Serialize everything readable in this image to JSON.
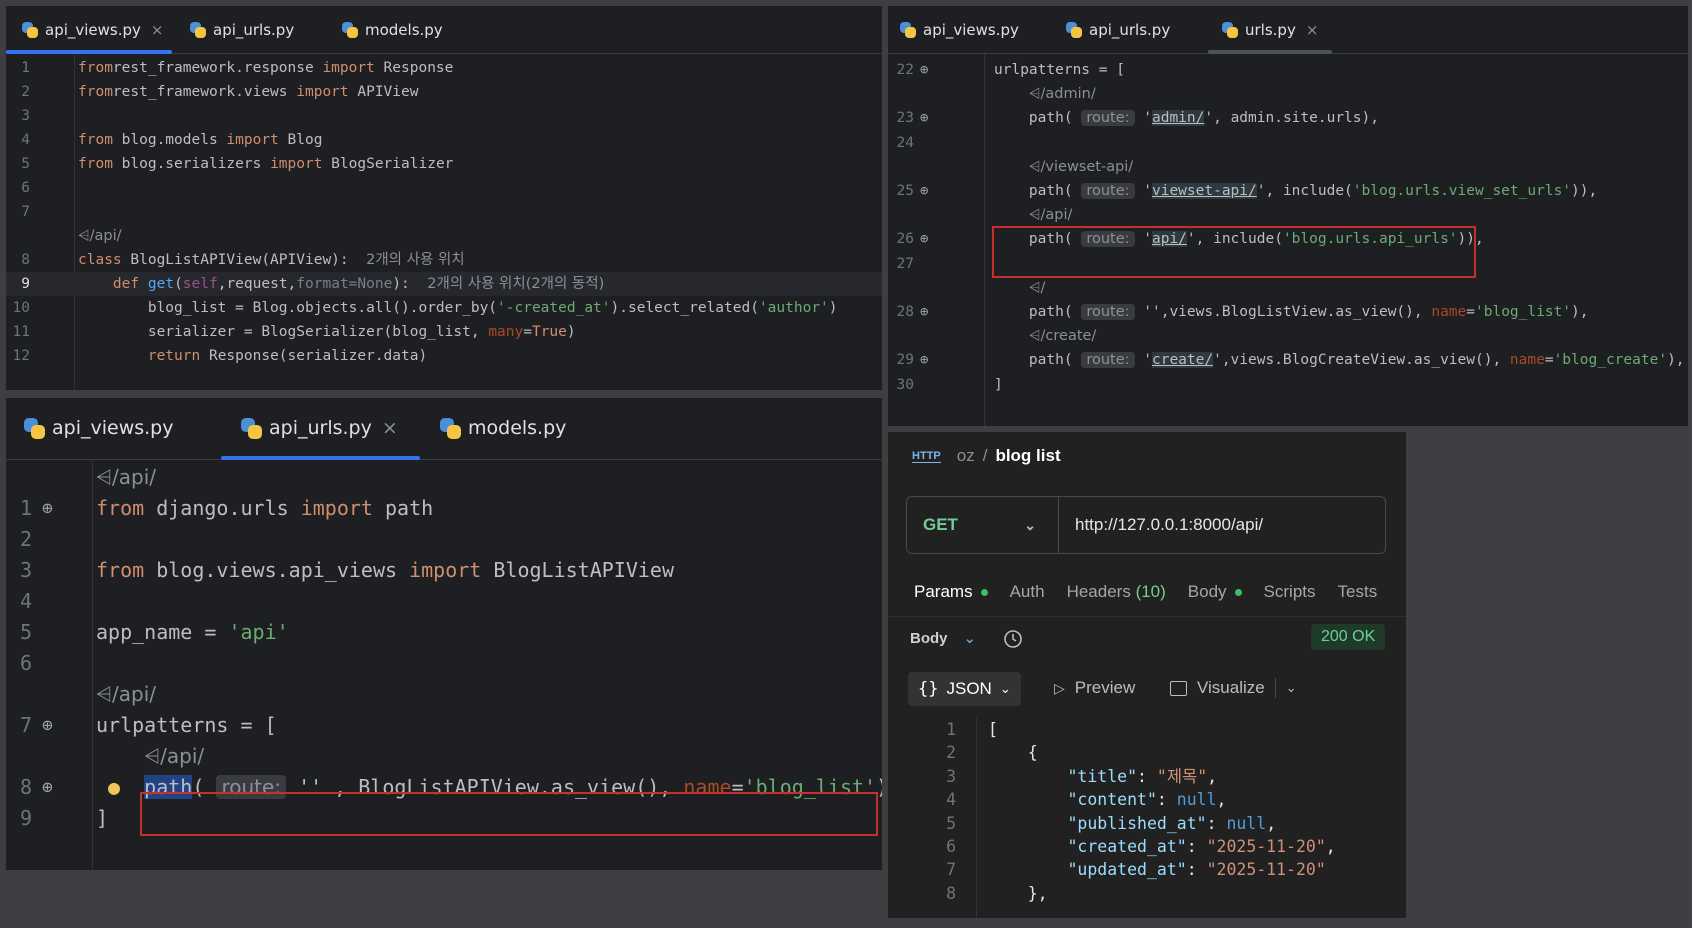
{
  "top_left": {
    "tabs": [
      {
        "label": "api_views.py",
        "active": true,
        "close": "×"
      },
      {
        "label": "api_urls.py",
        "active": false
      },
      {
        "label": "models.py",
        "active": false
      }
    ],
    "lines": [
      {
        "n": "1",
        "parts": [
          [
            "kw",
            "from"
          ],
          [
            "",
            "rest_framework.response "
          ],
          [
            "kw",
            "import"
          ],
          [
            "",
            " Response"
          ]
        ]
      },
      {
        "n": "2",
        "parts": [
          [
            "kw",
            "from"
          ],
          [
            "",
            "rest_framework.views "
          ],
          [
            "kw",
            "import"
          ],
          [
            "",
            " APIView"
          ]
        ]
      },
      {
        "n": "3",
        "parts": []
      },
      {
        "n": "4",
        "parts": [
          [
            "kw",
            "from"
          ],
          [
            "",
            " blog.models "
          ],
          [
            "kw",
            "import"
          ],
          [
            "",
            " Blog"
          ]
        ]
      },
      {
        "n": "5",
        "parts": [
          [
            "kw",
            "from"
          ],
          [
            "",
            " blog.serializers "
          ],
          [
            "kw",
            "import"
          ],
          [
            "",
            " BlogSerializer"
          ]
        ]
      },
      {
        "n": "6",
        "parts": []
      },
      {
        "n": "7",
        "parts": []
      },
      {
        "n": "",
        "parts": [
          [
            "ann",
            "⩤/api/"
          ]
        ]
      },
      {
        "n": "8",
        "parts": [
          [
            "kw",
            "class"
          ],
          [
            "",
            " BlogListAPIView(APIView):  "
          ],
          [
            "usage",
            "2개의 사용 위치"
          ]
        ]
      },
      {
        "n": "9",
        "parts": [
          [
            "",
            "    "
          ],
          [
            "kw",
            "def"
          ],
          [
            "",
            " "
          ],
          [
            "fn",
            "get"
          ],
          [
            "",
            "("
          ],
          [
            "slf",
            "self"
          ],
          [
            "",
            ",request,"
          ],
          [
            "grey",
            "format=None"
          ],
          [
            "",
            "):  "
          ],
          [
            "usage",
            "2개의 사용 위치(2개의 동적)"
          ]
        ]
      },
      {
        "n": "10",
        "parts": [
          [
            "",
            "        blog_list = Blog.objects.all().order_by("
          ],
          [
            "str",
            "'-created_at'"
          ],
          [
            "",
            ").select_related("
          ],
          [
            "str",
            "'author'"
          ],
          [
            "",
            ")"
          ]
        ]
      },
      {
        "n": "11",
        "parts": [
          [
            "",
            "        serializer = BlogSerializer(blog_list, "
          ],
          [
            "prm",
            "many"
          ],
          [
            "",
            "="
          ],
          [
            "kw",
            "True"
          ],
          [
            "",
            ")"
          ]
        ]
      },
      {
        "n": "12",
        "parts": [
          [
            "",
            "        "
          ],
          [
            "kw",
            "return"
          ],
          [
            "",
            " Response(serializer.data)"
          ]
        ]
      }
    ]
  },
  "top_right": {
    "tabs": [
      {
        "label": "api_views.py",
        "active": false
      },
      {
        "label": "api_urls.py",
        "active": false
      },
      {
        "label": "urls.py",
        "active": true,
        "close": "×"
      }
    ],
    "lines": [
      {
        "n": "22",
        "g": true,
        "parts": [
          [
            "",
            "urlpatterns = ["
          ]
        ]
      },
      {
        "n": "",
        "parts": [
          [
            "",
            "    "
          ],
          [
            "ann",
            "⩤/admin/"
          ]
        ]
      },
      {
        "n": "23",
        "g": true,
        "parts": [
          [
            "",
            "    path( "
          ],
          [
            "hint",
            "route:"
          ],
          [
            "",
            " '"
          ],
          [
            "ulink",
            "admin/"
          ],
          [
            "",
            "', admin.site.urls),"
          ]
        ]
      },
      {
        "n": "24",
        "parts": []
      },
      {
        "n": "",
        "parts": [
          [
            "",
            "    "
          ],
          [
            "ann",
            "⩤/viewset-api/"
          ]
        ]
      },
      {
        "n": "25",
        "g": true,
        "parts": [
          [
            "",
            "    path( "
          ],
          [
            "hint",
            "route:"
          ],
          [
            "",
            " '"
          ],
          [
            "ulink",
            "viewset-api/"
          ],
          [
            "",
            "', include("
          ],
          [
            "str",
            "'blog.urls.view_set_urls'"
          ],
          [
            "",
            ")),"
          ]
        ]
      },
      {
        "n": "",
        "parts": [
          [
            "",
            "    "
          ],
          [
            "ann",
            "⩤/api/"
          ]
        ]
      },
      {
        "n": "26",
        "g": true,
        "parts": [
          [
            "",
            "    path( "
          ],
          [
            "hint",
            "route:"
          ],
          [
            "",
            " '"
          ],
          [
            "ulink",
            "api/"
          ],
          [
            "",
            "', include("
          ],
          [
            "str",
            "'blog.urls.api_urls'"
          ],
          [
            "",
            ")),"
          ]
        ]
      },
      {
        "n": "27",
        "parts": []
      },
      {
        "n": "",
        "parts": [
          [
            "",
            "    "
          ],
          [
            "ann",
            "⩤/"
          ]
        ]
      },
      {
        "n": "28",
        "g": true,
        "parts": [
          [
            "",
            "    path( "
          ],
          [
            "hint",
            "route:"
          ],
          [
            "",
            " ''"
          ],
          [
            "",
            ",views.BlogListView.as_view(), "
          ],
          [
            "prm",
            "name"
          ],
          [
            "",
            "="
          ],
          [
            "str",
            "'blog_list'"
          ],
          [
            "",
            "),"
          ]
        ]
      },
      {
        "n": "",
        "parts": [
          [
            "",
            "    "
          ],
          [
            "ann",
            "⩤/create/"
          ]
        ]
      },
      {
        "n": "29",
        "g": true,
        "parts": [
          [
            "",
            "    path( "
          ],
          [
            "hint",
            "route:"
          ],
          [
            "",
            " '"
          ],
          [
            "ulink",
            "create/"
          ],
          [
            "",
            "',views.BlogCreateView.as_view(), "
          ],
          [
            "prm",
            "name"
          ],
          [
            "",
            "="
          ],
          [
            "str",
            "'blog_create'"
          ],
          [
            "",
            "),"
          ]
        ]
      },
      {
        "n": "30",
        "parts": [
          [
            "",
            "]"
          ]
        ]
      }
    ]
  },
  "bottom_left": {
    "tabs": [
      {
        "label": "api_views.py",
        "active": false
      },
      {
        "label": "api_urls.py",
        "active": true,
        "close": "×"
      },
      {
        "label": "models.py",
        "active": false
      }
    ],
    "lines": [
      {
        "n": "",
        "parts": [
          [
            "ann",
            "⩤/api/"
          ]
        ]
      },
      {
        "n": "1",
        "g": true,
        "parts": [
          [
            "kw",
            "from"
          ],
          [
            "",
            " django.urls "
          ],
          [
            "kw",
            "import"
          ],
          [
            "",
            " path"
          ]
        ]
      },
      {
        "n": "2",
        "parts": []
      },
      {
        "n": "3",
        "parts": [
          [
            "kw",
            "from"
          ],
          [
            "",
            " blog.views.api_views "
          ],
          [
            "kw",
            "import"
          ],
          [
            "",
            " BlogListAPIView"
          ]
        ]
      },
      {
        "n": "4",
        "parts": []
      },
      {
        "n": "5",
        "parts": [
          [
            "",
            "app_name = "
          ],
          [
            "str",
            "'api'"
          ]
        ]
      },
      {
        "n": "6",
        "parts": []
      },
      {
        "n": "",
        "parts": [
          [
            "ann",
            "⩤/api/"
          ]
        ]
      },
      {
        "n": "7",
        "g": true,
        "parts": [
          [
            "",
            "urlpatterns = ["
          ]
        ]
      },
      {
        "n": "",
        "parts": [
          [
            "",
            "    "
          ],
          [
            "ann",
            "⩤/api/"
          ]
        ]
      },
      {
        "n": "8",
        "g": true,
        "bulb": true,
        "parts": [
          [
            "",
            "    "
          ],
          [
            "hl-sel",
            "path"
          ],
          [
            "",
            "( "
          ],
          [
            "hint",
            "route:"
          ],
          [
            "",
            " '' , BlogListAPIView.as_view(), "
          ],
          [
            "prm",
            "name"
          ],
          [
            "",
            "="
          ],
          [
            "str",
            "'blog_list'"
          ],
          [
            "",
            "),"
          ]
        ]
      },
      {
        "n": "9",
        "parts": [
          [
            "",
            "]"
          ]
        ]
      }
    ]
  },
  "postman": {
    "http_label": "HTTP",
    "crumb_parent": "oz",
    "crumb_sep": "/",
    "crumb_title": "blog list",
    "method": "GET",
    "url": "http://127.0.0.1:8000/api/",
    "tabs": [
      {
        "label": "Params",
        "dot": true,
        "on": true
      },
      {
        "label": "Auth"
      },
      {
        "label": "Headers",
        "count": "(10)"
      },
      {
        "label": "Body",
        "dot": true
      },
      {
        "label": "Scripts"
      },
      {
        "label": "Tests"
      }
    ],
    "resp_body_label": "Body",
    "status": "200 OK",
    "format": "JSON",
    "preview": "Preview",
    "visualize": "Visualize",
    "json_lines": [
      {
        "n": "1",
        "parts": [
          [
            "",
            "["
          ]
        ]
      },
      {
        "n": "2",
        "parts": [
          [
            "",
            "    {"
          ]
        ]
      },
      {
        "n": "3",
        "parts": [
          [
            "",
            "        "
          ],
          [
            "jk",
            "\"title\""
          ],
          [
            "",
            ": "
          ],
          [
            "js",
            "\"제목\""
          ],
          [
            "",
            ","
          ]
        ]
      },
      {
        "n": "4",
        "parts": [
          [
            "",
            "        "
          ],
          [
            "jk",
            "\"content\""
          ],
          [
            "",
            ": "
          ],
          [
            "jn",
            "null"
          ],
          [
            "",
            ","
          ]
        ]
      },
      {
        "n": "5",
        "parts": [
          [
            "",
            "        "
          ],
          [
            "jk",
            "\"published_at\""
          ],
          [
            "",
            ": "
          ],
          [
            "jn",
            "null"
          ],
          [
            "",
            ","
          ]
        ]
      },
      {
        "n": "6",
        "parts": [
          [
            "",
            "        "
          ],
          [
            "jk",
            "\"created_at\""
          ],
          [
            "",
            ": "
          ],
          [
            "js",
            "\"2025-11-20\""
          ],
          [
            "",
            ","
          ]
        ]
      },
      {
        "n": "7",
        "parts": [
          [
            "",
            "        "
          ],
          [
            "jk",
            "\"updated_at\""
          ],
          [
            "",
            ": "
          ],
          [
            "js",
            "\"2025-11-20\""
          ]
        ]
      },
      {
        "n": "8",
        "parts": [
          [
            "",
            "    },"
          ]
        ]
      }
    ]
  }
}
